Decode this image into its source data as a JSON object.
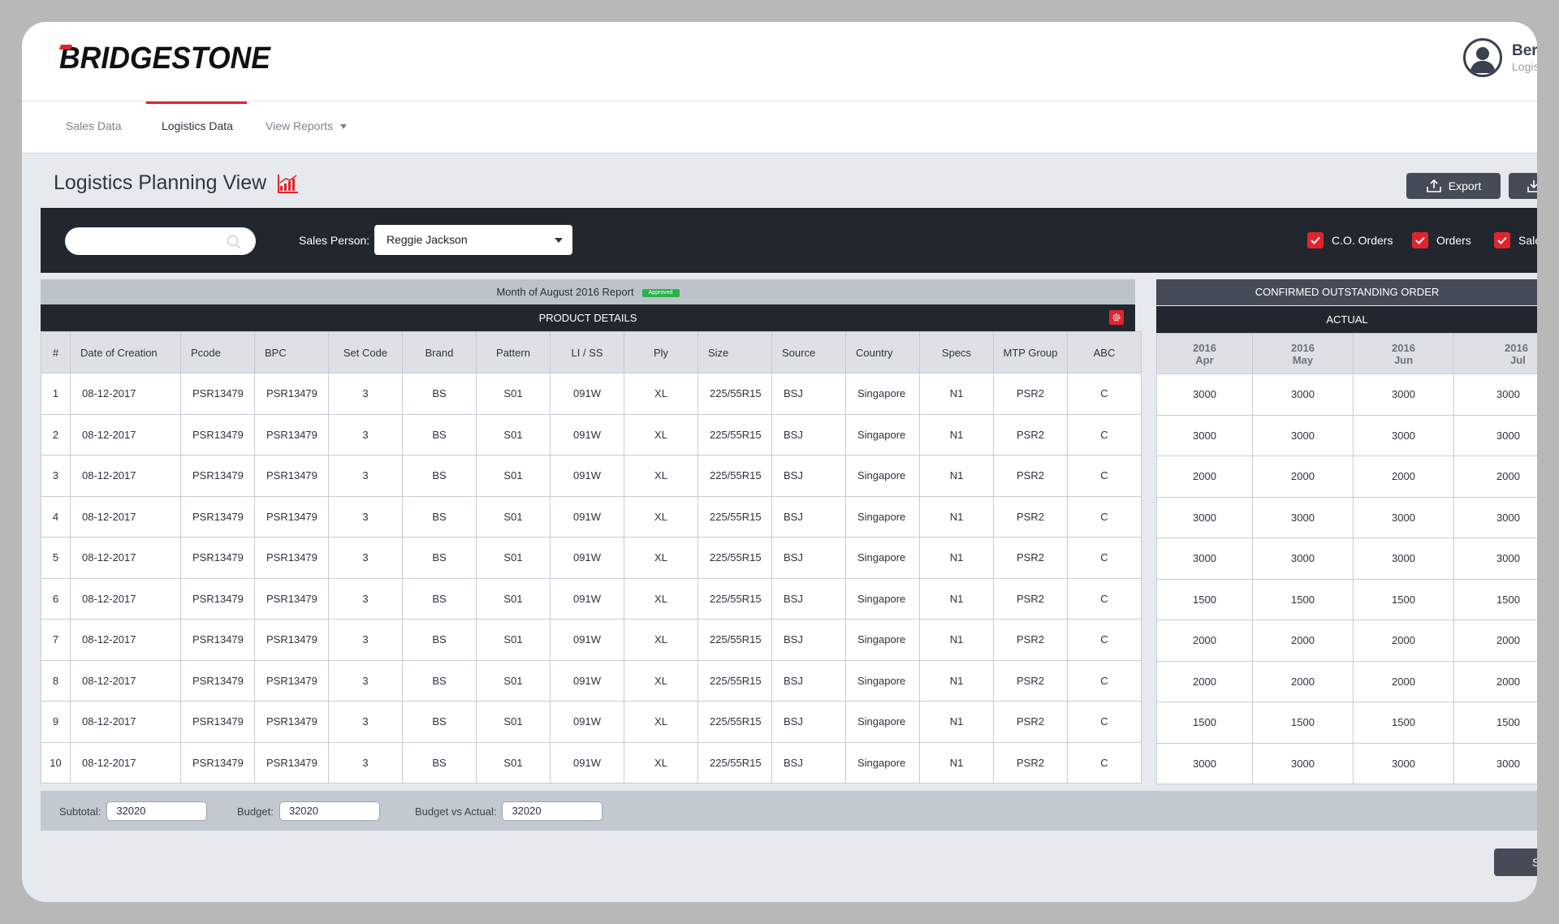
{
  "brand": {
    "logo_text": "BRIDGESTONE",
    "accent": "#e0242d"
  },
  "user": {
    "name": "Ber",
    "role": "Logis"
  },
  "nav": {
    "tabs": [
      {
        "label": "Sales Data",
        "active": false
      },
      {
        "label": "Logistics Data",
        "active": true
      },
      {
        "label": "View Reports",
        "active": false,
        "has_dropdown": true
      }
    ]
  },
  "page": {
    "title": "Logistics Planning View",
    "title_icon": "bar-chart-icon",
    "export_label": "Export",
    "save_label": "S"
  },
  "filters": {
    "search_placeholder": "",
    "sales_person_label": "Sales Person:",
    "sales_person_value": "Reggie Jackson",
    "checkboxes": [
      {
        "label": "C.O. Orders",
        "checked": true
      },
      {
        "label": "Orders",
        "checked": true
      },
      {
        "label": "Sales",
        "checked": true
      }
    ]
  },
  "report": {
    "title": "Month of August 2016 Report",
    "badge": "Approved",
    "section_title": "PRODUCT DETAILS",
    "columns": [
      "#",
      "Date of Creation",
      "Pcode",
      "BPC",
      "Set Code",
      "Brand",
      "Pattern",
      "LI / SS",
      "Ply",
      "Size",
      "Source",
      "Country",
      "Specs",
      "MTP Group",
      "ABC"
    ],
    "rows": [
      [
        "1",
        "08-12-2017",
        "PSR13479",
        "PSR13479",
        "3",
        "BS",
        "S01",
        "091W",
        "XL",
        "225/55R15",
        "BSJ",
        "Singapore",
        "N1",
        "PSR2",
        "C"
      ],
      [
        "2",
        "08-12-2017",
        "PSR13479",
        "PSR13479",
        "3",
        "BS",
        "S01",
        "091W",
        "XL",
        "225/55R15",
        "BSJ",
        "Singapore",
        "N1",
        "PSR2",
        "C"
      ],
      [
        "3",
        "08-12-2017",
        "PSR13479",
        "PSR13479",
        "3",
        "BS",
        "S01",
        "091W",
        "XL",
        "225/55R15",
        "BSJ",
        "Singapore",
        "N1",
        "PSR2",
        "C"
      ],
      [
        "4",
        "08-12-2017",
        "PSR13479",
        "PSR13479",
        "3",
        "BS",
        "S01",
        "091W",
        "XL",
        "225/55R15",
        "BSJ",
        "Singapore",
        "N1",
        "PSR2",
        "C"
      ],
      [
        "5",
        "08-12-2017",
        "PSR13479",
        "PSR13479",
        "3",
        "BS",
        "S01",
        "091W",
        "XL",
        "225/55R15",
        "BSJ",
        "Singapore",
        "N1",
        "PSR2",
        "C"
      ],
      [
        "6",
        "08-12-2017",
        "PSR13479",
        "PSR13479",
        "3",
        "BS",
        "S01",
        "091W",
        "XL",
        "225/55R15",
        "BSJ",
        "Singapore",
        "N1",
        "PSR2",
        "C"
      ],
      [
        "7",
        "08-12-2017",
        "PSR13479",
        "PSR13479",
        "3",
        "BS",
        "S01",
        "091W",
        "XL",
        "225/55R15",
        "BSJ",
        "Singapore",
        "N1",
        "PSR2",
        "C"
      ],
      [
        "8",
        "08-12-2017",
        "PSR13479",
        "PSR13479",
        "3",
        "BS",
        "S01",
        "091W",
        "XL",
        "225/55R15",
        "BSJ",
        "Singapore",
        "N1",
        "PSR2",
        "C"
      ],
      [
        "9",
        "08-12-2017",
        "PSR13479",
        "PSR13479",
        "3",
        "BS",
        "S01",
        "091W",
        "XL",
        "225/55R15",
        "BSJ",
        "Singapore",
        "N1",
        "PSR2",
        "C"
      ],
      [
        "10",
        "08-12-2017",
        "PSR13479",
        "PSR13479",
        "3",
        "BS",
        "S01",
        "091W",
        "XL",
        "225/55R15",
        "BSJ",
        "Singapore",
        "N1",
        "PSR2",
        "C"
      ]
    ]
  },
  "outstanding": {
    "title": "CONFIRMED OUTSTANDING ORDER",
    "subtitle": "ACTUAL",
    "columns": [
      {
        "year": "2016",
        "month": "Apr"
      },
      {
        "year": "2016",
        "month": "May"
      },
      {
        "year": "2016",
        "month": "Jun"
      },
      {
        "year": "2016",
        "month": "Jul"
      }
    ],
    "rows": [
      [
        "3000",
        "3000",
        "3000",
        "3000"
      ],
      [
        "3000",
        "3000",
        "3000",
        "3000"
      ],
      [
        "2000",
        "2000",
        "2000",
        "2000"
      ],
      [
        "3000",
        "3000",
        "3000",
        "3000"
      ],
      [
        "3000",
        "3000",
        "3000",
        "3000"
      ],
      [
        "1500",
        "1500",
        "1500",
        "1500"
      ],
      [
        "2000",
        "2000",
        "2000",
        "2000"
      ],
      [
        "2000",
        "2000",
        "2000",
        "2000"
      ],
      [
        "1500",
        "1500",
        "1500",
        "1500"
      ],
      [
        "3000",
        "3000",
        "3000",
        "3000"
      ]
    ]
  },
  "totals": {
    "subtotal_label": "Subtotal:",
    "subtotal_value": "32020",
    "budget_label": "Budget:",
    "budget_value": "32020",
    "bva_label": "Budget vs Actual:",
    "bva_value": "32020"
  }
}
